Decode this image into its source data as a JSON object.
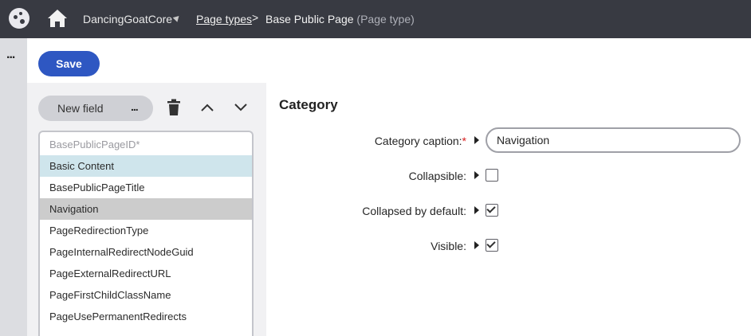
{
  "header": {
    "site_name": "DancingGoatCore",
    "breadcrumb_link": "Page types",
    "breadcrumb_separator": ">",
    "breadcrumb_current": "Base Public Page",
    "breadcrumb_current_suffix": "(Page type)"
  },
  "rail": {
    "more_label": "..."
  },
  "toolbar": {
    "save_label": "Save"
  },
  "fields_panel": {
    "new_field_label": "New field",
    "new_field_more": "...",
    "items": [
      {
        "label": "BasePublicPageID*",
        "state": "disabled"
      },
      {
        "label": "Basic Content",
        "state": "category"
      },
      {
        "label": "BasePublicPageTitle",
        "state": "normal"
      },
      {
        "label": "Navigation",
        "state": "selected"
      },
      {
        "label": "PageRedirectionType",
        "state": "normal"
      },
      {
        "label": "PageInternalRedirectNodeGuid",
        "state": "normal"
      },
      {
        "label": "PageExternalRedirectURL",
        "state": "normal"
      },
      {
        "label": "PageFirstChildClassName",
        "state": "normal"
      },
      {
        "label": "PageUsePermanentRedirects",
        "state": "normal"
      }
    ]
  },
  "form": {
    "section_title": "Category",
    "caption_label": "Category caption:",
    "caption_required_mark": "*",
    "caption_value": "Navigation",
    "collapsible_label": "Collapsible:",
    "collapsible_checked": false,
    "collapsed_default_label": "Collapsed by default:",
    "collapsed_default_checked": true,
    "visible_label": "Visible:",
    "visible_checked": true
  },
  "colors": {
    "topbar": "#383a42",
    "primary": "#2e57c2",
    "category_highlight": "#cfe5ec",
    "selected_item": "#cccccc",
    "required": "#d81b1b"
  },
  "icons": [
    "app-logo-icon",
    "home-icon",
    "more-icon",
    "trash-icon",
    "chevron-up-icon",
    "chevron-down-icon",
    "expand-triangle-icon",
    "checkbox-check-icon"
  ]
}
